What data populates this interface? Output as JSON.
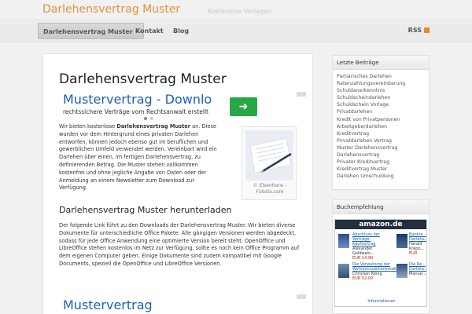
{
  "header": {
    "site_title": "Darlehensvertrag Muster",
    "tagline": "Kostenlose Vorlagen"
  },
  "nav": {
    "items": [
      {
        "label": "Darlehensvertrag Muster"
      },
      {
        "label": "Kontakt"
      },
      {
        "label": "Blog"
      }
    ],
    "rss_label": "RSS"
  },
  "main": {
    "title": "Darlehensvertrag Muster",
    "ad_top": {
      "headline": "Mustervertrag - Downlo",
      "subline": "rechtssichere Verträge vom Rechtsanwalt erstellt",
      "arrow": "➜"
    },
    "intro_prefix": "Wir bieten kostenlose ",
    "intro_bold": "Darlehensvertrag Muster",
    "intro_rest": " an. Diese wurden vor dem Hintergrund eines privaten Darlehen entworfen, können jedoch ebenso gut im beruflichen und gewerblichen Umfeld verwendet werden. Vereinbart wird ein Darlehen über einen, im fertigen Darlehensvertrag, zu definierenden Betrag. Die Muster stehen vollkommen kostenfrei und ohne jegliche Angabe von Daten oder der Anmeldung an einem Newsletter zum Download zur Verfügung.",
    "figure_caption": "© Elsenhans - Fotolia.com",
    "download_heading": "Darlehensvertrag Muster herunterladen",
    "download_text": "Der folgende Link führt zu den Downloads der Darlehensvertrag Muster. Wir bieten diverse Dokumente für unterschiedliche Office Pakete. Alle gängigen Versionen werden abgedeckt, sodass für jede Office Anwendung eine optimierte Version bereit steht. OpenOffice und LibreOffice stehen kostenlos im Netz zur Verfügung, sollte es noch kein Office Programm auf dem eigenen Computer geben. Einige Dokumente sind zudem kompatibel mit Google Documents, speziell die OpenOffice und LibreOffice Versionen.",
    "ad_bottom": {
      "headline": "Mustervertrag"
    }
  },
  "sidebar": {
    "recent_title": "Letzte Beiträge",
    "recent_posts": [
      "Partiarisches Darlehen",
      "Ratenzahlungsvereinbarung",
      "Schuldanerkenntnis",
      "Schuldscheindarlehen",
      "Schuldschein Vorlage",
      "Privatdarlehen",
      "Kredit von Privatpersonen",
      "Arbeitgeberdarlehen",
      "Kreditvertrag",
      "Privatdarlehen Vertrag",
      "Muster Darlehensvertrag",
      "Darlehensvertrag",
      "Privater Kreditvertrag",
      "Kreditvertrag Muster",
      "Darlehen Umschuldung"
    ],
    "books_title": "Buchempfehlung",
    "amazon": {
      "logo": "amazon.de",
      "products": [
        {
          "title": "Abschluss der Verträge: Kaufvertrag",
          "author": "Alexander Goldwein...",
          "price": "EUR 14,90"
        },
        {
          "title": "Bankre... Darlehe...",
          "author": "Harald Krepo...",
          "price": "EUR"
        },
        {
          "title": "Die Verwaltung der Wohnimmobilienkredit...",
          "author": "Christian König",
          "price": "EUR 52,00"
        },
        {
          "title": "Die Re... Darlehe...",
          "author": "Manue...",
          "price": ""
        }
      ],
      "info": "Informationen"
    }
  },
  "colors": {
    "site_title": "#e0923d",
    "link_blue": "#1a62b5",
    "ad_green": "#27a844",
    "rss_orange": "#e8872d"
  }
}
